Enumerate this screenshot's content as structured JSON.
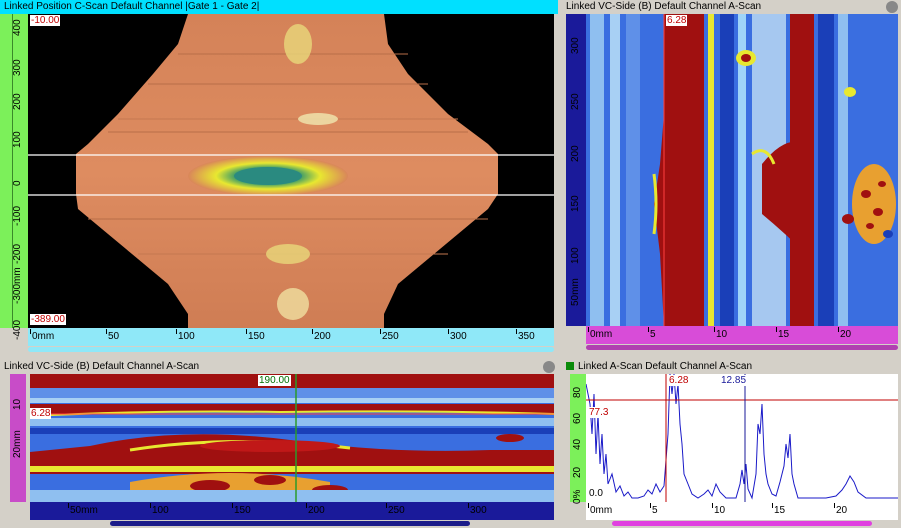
{
  "panels": {
    "cscan": {
      "title": "Linked Position C-Scan Default Channel |Gate 1 - Gate 2|",
      "top_value": "-10.00",
      "bottom_value": "-389.00",
      "vticks": [
        "400",
        "300",
        "200",
        "100",
        "0",
        "-100",
        "-200",
        "-300mm",
        "-400"
      ],
      "hticks": [
        "0mm",
        "50",
        "100",
        "150",
        "200",
        "250",
        "300",
        "350"
      ]
    },
    "vc_side_right": {
      "title": "Linked VC-Side (B) Default Channel A-Scan",
      "cursor_value": "6.28",
      "vticks": [
        "300",
        "250",
        "200",
        "150",
        "100",
        "50mm"
      ],
      "hticks": [
        "0mm",
        "5",
        "10",
        "15",
        "20"
      ]
    },
    "vc_side_bottom": {
      "title": "Linked VC-Side (B) Default Channel A-Scan",
      "cursor_value": "190.00",
      "gate_value": "6.28",
      "vticks": [
        "10",
        "20mm"
      ],
      "hticks": [
        "50mm",
        "100",
        "150",
        "200",
        "250",
        "300"
      ]
    },
    "ascan": {
      "title": "Linked A-Scan Default Channel A-Scan",
      "gate1_value": "6.28",
      "gate2_value": "12.85",
      "amplitude_value": "77.3",
      "zero_value": "0.0",
      "vticks": [
        "80",
        "60",
        "40",
        "20",
        "0%"
      ],
      "hticks": [
        "0mm",
        "5",
        "10",
        "15",
        "20"
      ]
    }
  },
  "colors": {
    "active_title": "#00e0ff",
    "bscan_red": "#a01010",
    "bscan_blue": "#1a4fd0",
    "cscan_orange": "#d9865a",
    "gate_red": "#c00000",
    "gate_blue": "#1a1a9a",
    "signal_blue": "#1a1ac8"
  },
  "icons": {
    "close": "close-icon",
    "channel_indicator": "square-icon"
  }
}
